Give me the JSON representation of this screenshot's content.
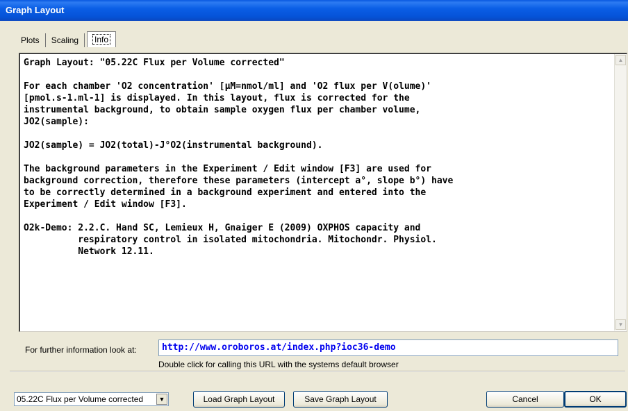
{
  "window": {
    "title": "Graph Layout"
  },
  "tabs": [
    {
      "label": "Plots"
    },
    {
      "label": "Scaling"
    },
    {
      "label": "Info"
    }
  ],
  "info": {
    "lines": [
      "Graph Layout: \"05.22C Flux per Volume corrected\"",
      "",
      "For each chamber 'O2 concentration' [µM=nmol/ml] and 'O2 flux per V(olume)'",
      "[pmol.s-1.ml-1] is displayed. In this layout, flux is corrected for the",
      "instrumental background, to obtain sample oxygen flux per chamber volume,",
      "JO2(sample):",
      "",
      "JO2(sample) = JO2(total)-J°O2(instrumental background).",
      "",
      "The background parameters in the Experiment / Edit window [F3] are used for",
      "background correction, therefore these parameters (intercept a°, slope b°) have",
      "to be correctly determined in a background experiment and entered into the",
      "Experiment / Edit window [F3].",
      "",
      "O2k-Demo: 2.2.C. Hand SC, Lemieux H, Gnaiger E (2009) OXPHOS capacity and",
      "          respiratory control in isolated mitochondria. Mitochondr. Physiol.",
      "          Network 12.11."
    ]
  },
  "further_info": {
    "label": "For further information look at:",
    "url": "http://www.oroboros.at/index.php?ioc36-demo",
    "hint": "Double click for calling this URL with the systems default browser"
  },
  "layout_select": {
    "value": "05.22C Flux per Volume corrected"
  },
  "buttons": {
    "load": "Load Graph Layout",
    "save": "Save Graph Layout",
    "cancel": "Cancel",
    "ok": "OK"
  },
  "icons": {
    "scroll_up": "scroll-up-arrow-icon",
    "scroll_down": "scroll-down-arrow-icon",
    "dropdown": "dropdown-arrow-icon"
  }
}
